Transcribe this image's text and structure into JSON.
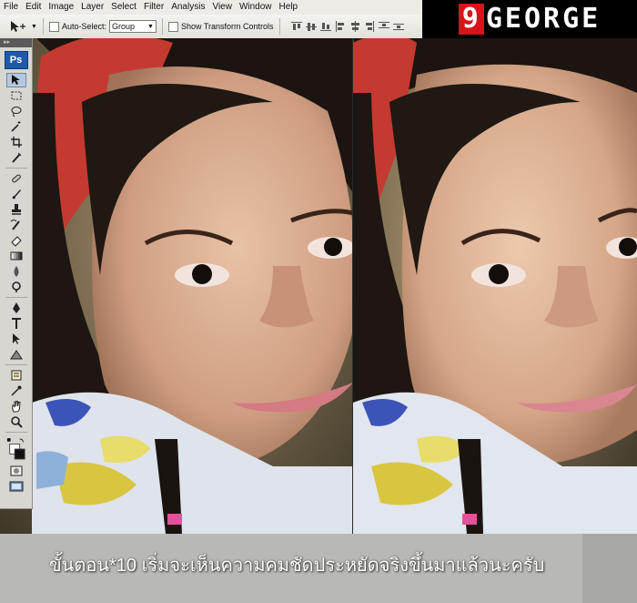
{
  "menu": {
    "items": [
      "File",
      "Edit",
      "Image",
      "Layer",
      "Select",
      "Filter",
      "Analysis",
      "View",
      "Window",
      "Help"
    ]
  },
  "options": {
    "auto_select_label": "Auto-Select:",
    "auto_select_value": "Group",
    "show_transform_label": "Show Transform Controls"
  },
  "brand": {
    "number": "9",
    "name": "GEORGE"
  },
  "toolbox": {
    "logo": "Ps"
  },
  "caption": {
    "text": "ขั้นตอน*10 เริ่มจะเห็นความคมชัดประหยัดจริงขึ้นมาแล้วนะครับ"
  },
  "colors": {
    "brand_red": "#d8141a",
    "ps_blue": "#1e5aa8"
  }
}
